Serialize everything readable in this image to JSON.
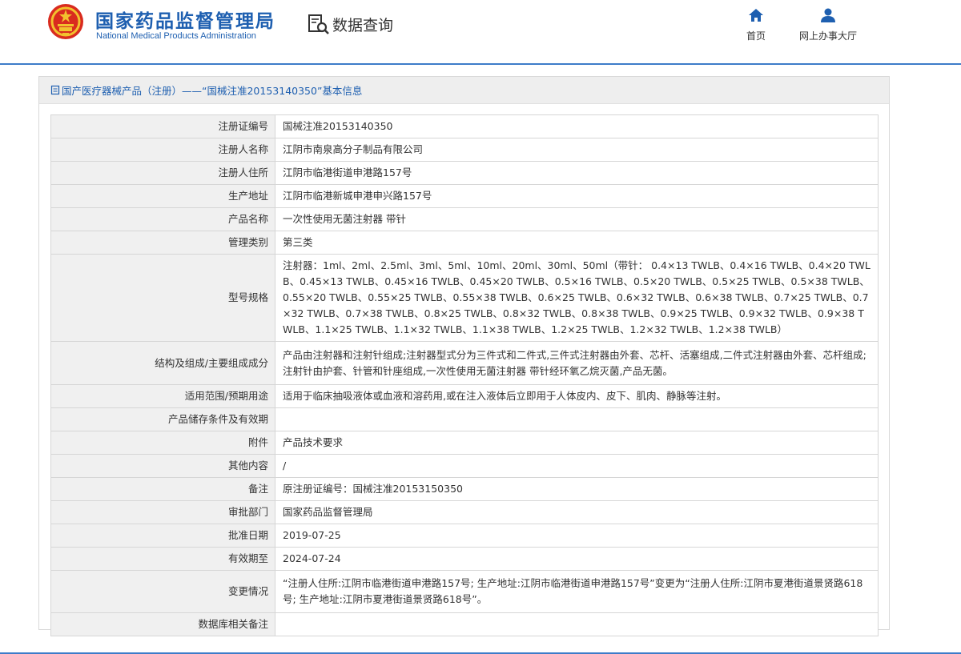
{
  "header": {
    "site_title": "国家药品监督管理局",
    "site_subtitle": "National Medical Products Administration",
    "query_label": "数据查询",
    "nav": [
      {
        "label": "首页",
        "icon": "home-icon"
      },
      {
        "label": "网上办事大厅",
        "icon": "user-icon"
      }
    ],
    "colors": {
      "brand": "#1e5fb0",
      "accent_line": "#3d7cc9"
    }
  },
  "panel": {
    "breadcrumb": "国产医疗器械产品（注册）——“国械注准20153140350”基本信息"
  },
  "rows": [
    {
      "key": "注册证编号",
      "value": "国械注准20153140350"
    },
    {
      "key": "注册人名称",
      "value": "江阴市南泉高分子制品有限公司"
    },
    {
      "key": "注册人住所",
      "value": "江阴市临港街道申港路157号"
    },
    {
      "key": "生产地址",
      "value": "江阴市临港新城申港申兴路157号"
    },
    {
      "key": "产品名称",
      "value": "一次性使用无菌注射器 带针"
    },
    {
      "key": "管理类别",
      "value": "第三类"
    },
    {
      "key": "型号规格",
      "value": "注射器：1ml、2ml、2.5ml、3ml、5ml、10ml、20ml、30ml、50ml（带针： 0.4×13 TWLB、0.4×16 TWLB、0.4×20 TWLB、0.45×13 TWLB、0.45×16 TWLB、0.45×20 TWLB、0.5×16 TWLB、0.5×20 TWLB、0.5×25 TWLB、0.5×38 TWLB、0.55×20 TWLB、0.55×25 TWLB、0.55×38 TWLB、0.6×25 TWLB、0.6×32 TWLB、0.6×38 TWLB、0.7×25 TWLB、0.7×32 TWLB、0.7×38 TWLB、0.8×25 TWLB、0.8×32 TWLB、0.8×38 TWLB、0.9×25 TWLB、0.9×32 TWLB、0.9×38 TWLB、1.1×25 TWLB、1.1×32 TWLB、1.1×38 TWLB、1.2×25 TWLB、1.2×32 TWLB、1.2×38 TWLB）"
    },
    {
      "key": "结构及组成/主要组成成分",
      "value": "产品由注射器和注射针组成;注射器型式分为三件式和二件式,三件式注射器由外套、芯杆、活塞组成,二件式注射器由外套、芯杆组成;注射针由护套、针管和针座组成,一次性使用无菌注射器 带针经环氧乙烷灭菌,产品无菌。"
    },
    {
      "key": "适用范围/预期用途",
      "value": "适用于临床抽吸液体或血液和溶药用,或在注入液体后立即用于人体皮内、皮下、肌肉、静脉等注射。"
    },
    {
      "key": "产品储存条件及有效期",
      "value": ""
    },
    {
      "key": "附件",
      "value": "产品技术要求"
    },
    {
      "key": "其他内容",
      "value": "/"
    },
    {
      "key": "备注",
      "value": "原注册证编号：国械注准20153150350"
    },
    {
      "key": "审批部门",
      "value": "国家药品监督管理局"
    },
    {
      "key": "批准日期",
      "value": "2019-07-25"
    },
    {
      "key": "有效期至",
      "value": "2024-07-24"
    },
    {
      "key": "变更情况",
      "value": "“注册人住所:江阴市临港街道申港路157号; 生产地址:江阴市临港街道申港路157号”变更为“注册人住所:江阴市夏港街道景贤路618号; 生产地址:江阴市夏港街道景贤路618号”。"
    },
    {
      "key": "数据库相关备注",
      "value": ""
    }
  ]
}
